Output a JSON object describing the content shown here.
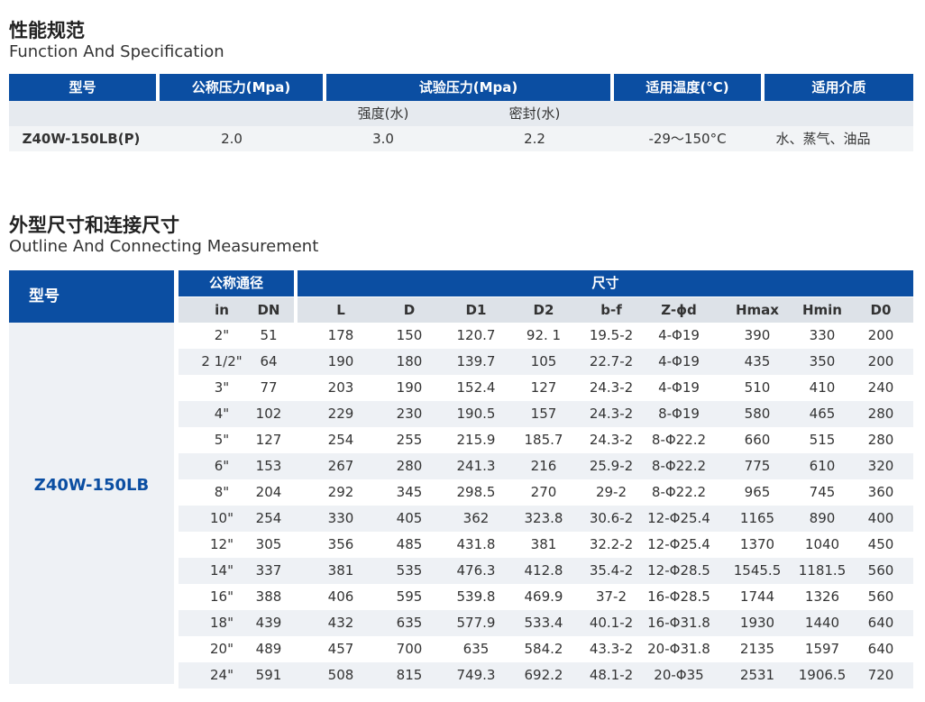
{
  "spec_section": {
    "title_cn": "性能规范",
    "title_en": "Function And Specification",
    "headers": [
      "型号",
      "公称压力(Mpa)",
      "试验压力(Mpa)",
      "适用温度(°C)",
      "适用介质"
    ],
    "sub_headers": [
      "强度(水)",
      "密封(水)"
    ],
    "row": [
      "Z40W-150LB(P)",
      "2.0",
      "3.0",
      "2.2",
      "-29～150°C",
      "水、蒸气、油品"
    ]
  },
  "dim_section": {
    "title_cn": "外型尺寸和连接尺寸",
    "title_en": "Outline And Connecting Measurement",
    "model_header": "型号",
    "nominal_header": "公称通径",
    "size_header": "尺寸",
    "columns": [
      "in",
      "DN",
      "L",
      "D",
      "D1",
      "D2",
      "b-f",
      "Z-ϕd",
      "Hmax",
      "Hmin",
      "D0"
    ],
    "model_name": "Z40W-150LB",
    "rows": [
      [
        "2\"",
        "51",
        "178",
        "150",
        "120.7",
        "92. 1",
        "19.5-2",
        "4-Φ19",
        "390",
        "330",
        "200"
      ],
      [
        "2 1/2\"",
        "64",
        "190",
        "180",
        "139.7",
        "105",
        "22.7-2",
        "4-Φ19",
        "435",
        "350",
        "200"
      ],
      [
        "3\"",
        "77",
        "203",
        "190",
        "152.4",
        "127",
        "24.3-2",
        "4-Φ19",
        "510",
        "410",
        "240"
      ],
      [
        "4\"",
        "102",
        "229",
        "230",
        "190.5",
        "157",
        "24.3-2",
        "8-Φ19",
        "580",
        "465",
        "280"
      ],
      [
        "5\"",
        "127",
        "254",
        "255",
        "215.9",
        "185.7",
        "24.3-2",
        "8-Φ22.2",
        "660",
        "515",
        "280"
      ],
      [
        "6\"",
        "153",
        "267",
        "280",
        "241.3",
        "216",
        "25.9-2",
        "8-Φ22.2",
        "775",
        "610",
        "320"
      ],
      [
        "8\"",
        "204",
        "292",
        "345",
        "298.5",
        "270",
        "29-2",
        "8-Φ22.2",
        "965",
        "745",
        "360"
      ],
      [
        "10\"",
        "254",
        "330",
        "405",
        "362",
        "323.8",
        "30.6-2",
        "12-Φ25.4",
        "1165",
        "890",
        "400"
      ],
      [
        "12\"",
        "305",
        "356",
        "485",
        "431.8",
        "381",
        "32.2-2",
        "12-Φ25.4",
        "1370",
        "1040",
        "450"
      ],
      [
        "14\"",
        "337",
        "381",
        "535",
        "476.3",
        "412.8",
        "35.4-2",
        "12-Φ28.5",
        "1545.5",
        "1181.5",
        "560"
      ],
      [
        "16\"",
        "388",
        "406",
        "595",
        "539.8",
        "469.9",
        "37-2",
        "16-Φ28.5",
        "1744",
        "1326",
        "560"
      ],
      [
        "18\"",
        "439",
        "432",
        "635",
        "577.9",
        "533.4",
        "40.1-2",
        "16-Φ31.8",
        "1930",
        "1440",
        "640"
      ],
      [
        "20\"",
        "489",
        "457",
        "700",
        "635",
        "584.2",
        "43.3-2",
        "20-Φ31.8",
        "2135",
        "1597",
        "640"
      ],
      [
        "24\"",
        "591",
        "508",
        "815",
        "749.3",
        "692.2",
        "48.1-2",
        "20-Φ35",
        "2531",
        "1906.5",
        "720"
      ]
    ]
  },
  "colors": {
    "header_blue": "#0b4ea2",
    "row_gray": "#eef1f5",
    "model_text": "#0b4ea2"
  }
}
